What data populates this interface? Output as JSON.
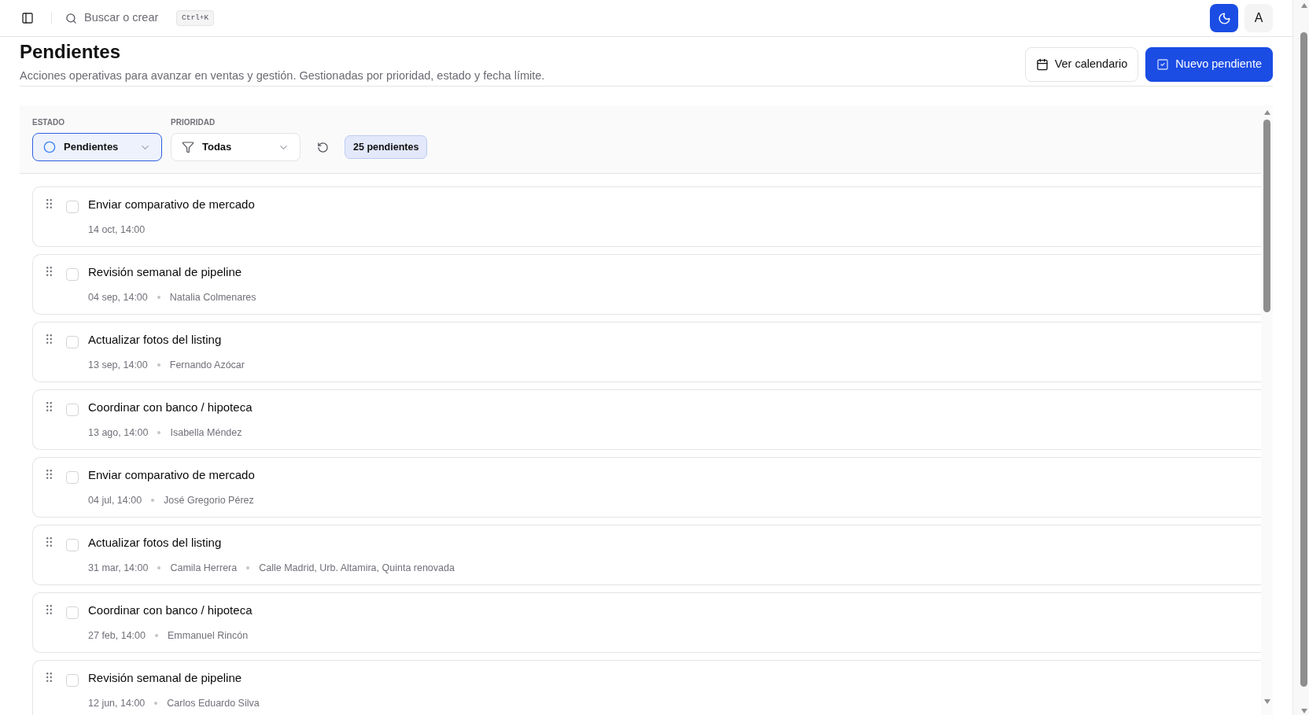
{
  "topbar": {
    "search": {
      "placeholder": "Buscar o crear",
      "shortcut": "Ctrl+K"
    },
    "theme_toggle": {
      "on": true
    },
    "avatar": "A"
  },
  "header": {
    "title": "Pendientes",
    "subtitle": "Acciones operativas para avanzar en ventas y gestión. Gestionadas por prioridad, estado y fecha límite.",
    "buttons": [
      {
        "label": "Ver calendario",
        "kind": "calendar"
      },
      {
        "label": "Nuevo pendiente",
        "kind": "create"
      }
    ]
  },
  "filters": [
    {
      "label": "ESTADO",
      "value": "Pendientes",
      "kind": "status",
      "active": true
    },
    {
      "label": "PRIORIDAD",
      "value": "Todas",
      "kind": "priority",
      "active": false
    }
  ],
  "count_badge": "25 pendientes",
  "tasks": [
    {
      "title": "Enviar comparativo de mercado",
      "due": "14 oct, 14:00",
      "checked": false
    },
    {
      "title": "Revisión semanal de pipeline",
      "due": "04 sep, 14:00",
      "assignee": "Natalia Colmenares",
      "checked": false
    },
    {
      "title": "Actualizar fotos del listing",
      "due": "13 sep, 14:00",
      "assignee": "Fernando Azócar",
      "checked": false
    },
    {
      "title": "Coordinar con banco / hipoteca",
      "due": "13 ago, 14:00",
      "assignee": "Isabella Méndez",
      "checked": false
    },
    {
      "title": "Enviar comparativo de mercado",
      "due": "04 jul, 14:00",
      "assignee": "José Gregorio Pérez",
      "checked": false
    },
    {
      "title": "Actualizar fotos del listing",
      "due": "31 mar, 14:00",
      "assignee": "Camila Herrera",
      "property": "Calle Madrid, Urb. Altamira, Quinta renovada",
      "checked": false
    },
    {
      "title": "Coordinar con banco / hipoteca",
      "due": "27 feb, 14:00",
      "assignee": "Emmanuel Rincón",
      "checked": false
    },
    {
      "title": "Revisión semanal de pipeline",
      "due": "12 jun, 14:00",
      "assignee": "Carlos Eduardo Silva",
      "checked": false
    }
  ]
}
